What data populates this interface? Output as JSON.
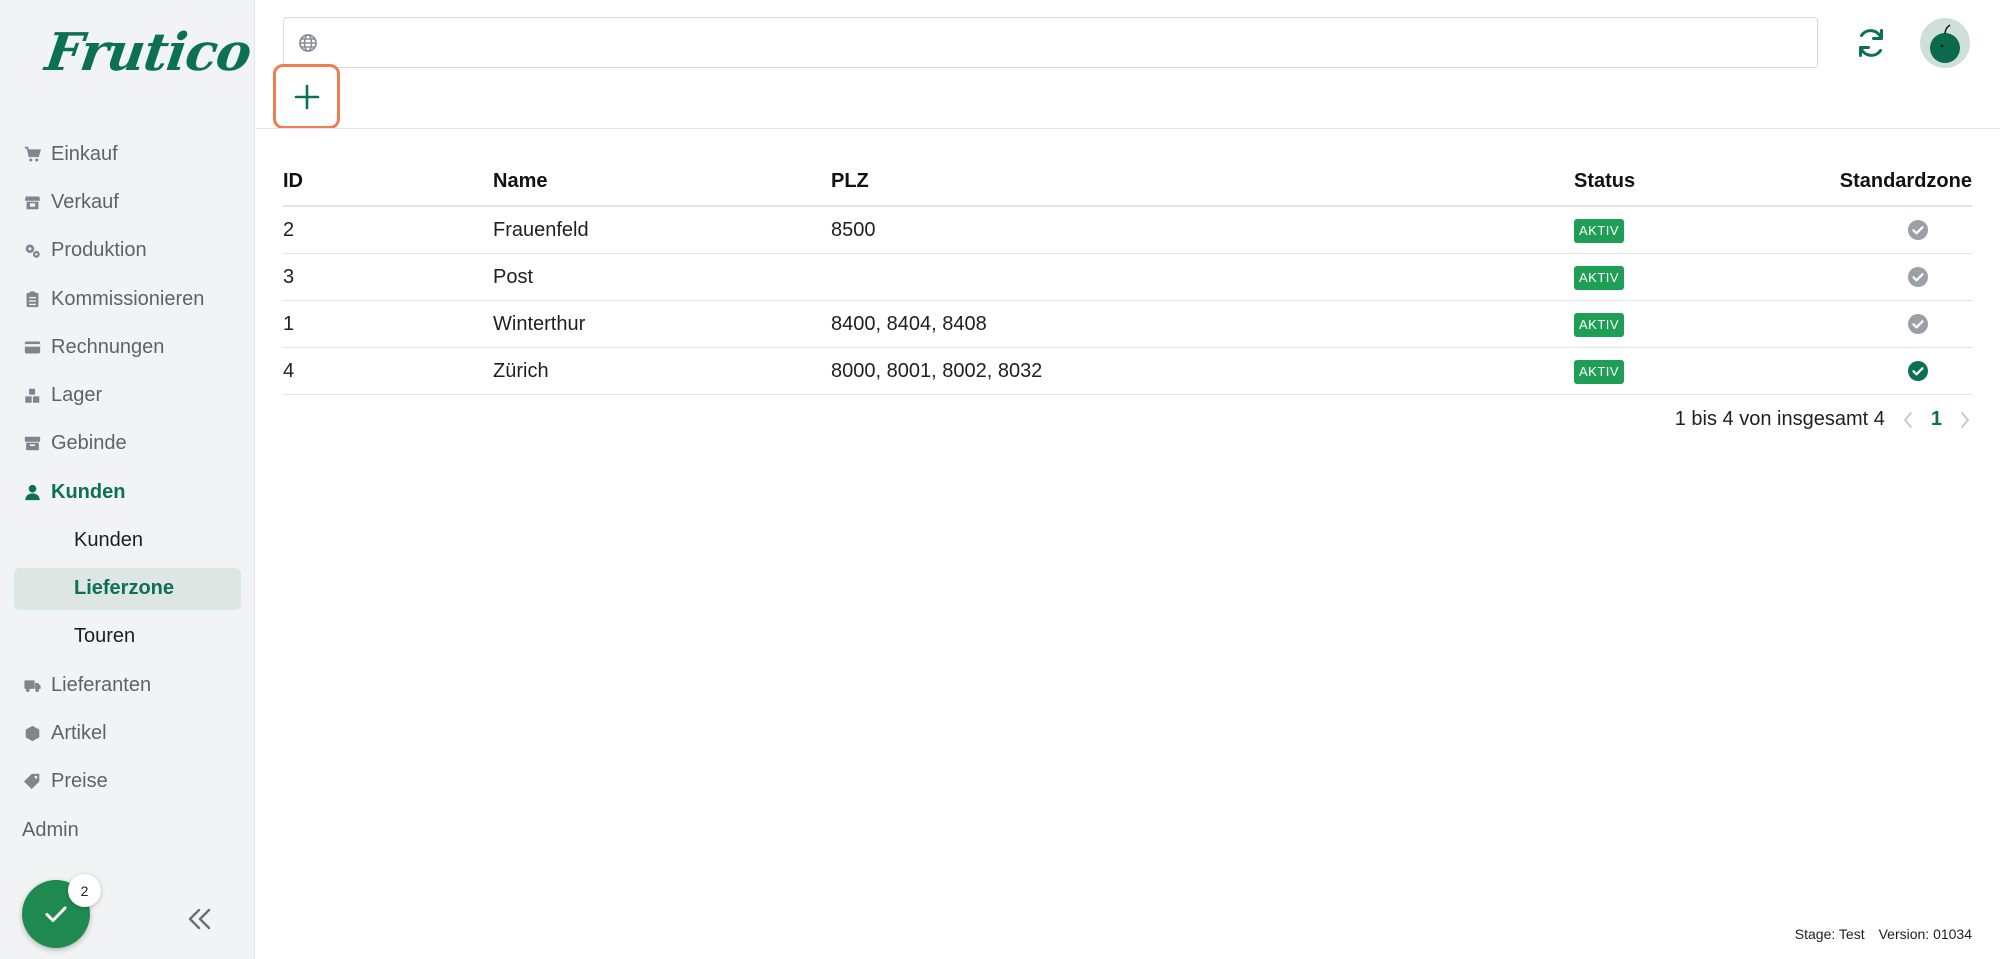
{
  "app": {
    "logo": "Frutico"
  },
  "sidebar": {
    "items": [
      {
        "label": "Einkauf",
        "icon": "cart-icon"
      },
      {
        "label": "Verkauf",
        "icon": "store-icon"
      },
      {
        "label": "Produktion",
        "icon": "gears-icon"
      },
      {
        "label": "Kommissionieren",
        "icon": "clipboard-icon"
      },
      {
        "label": "Rechnungen",
        "icon": "credit-card-icon"
      },
      {
        "label": "Lager",
        "icon": "boxes-icon"
      },
      {
        "label": "Gebinde",
        "icon": "archive-box-icon"
      },
      {
        "label": "Kunden",
        "icon": "user-icon"
      }
    ],
    "sub_items": [
      {
        "label": "Kunden"
      },
      {
        "label": "Lieferzone"
      },
      {
        "label": "Touren"
      }
    ],
    "items_after": [
      {
        "label": "Lieferanten",
        "icon": "truck-icon"
      },
      {
        "label": "Artikel",
        "icon": "cube-icon"
      },
      {
        "label": "Preise",
        "icon": "tag-icon"
      }
    ],
    "admin_label": "Admin",
    "fab_badge": "2"
  },
  "topbar": {
    "url_value": "",
    "url_placeholder": ""
  },
  "table": {
    "headers": {
      "id": "ID",
      "name": "Name",
      "plz": "PLZ",
      "status": "Status",
      "standard": "Standardzone"
    },
    "rows": [
      {
        "id": "2",
        "name": "Frauenfeld",
        "plz": "8500",
        "status": "AKTIV",
        "standard": false
      },
      {
        "id": "3",
        "name": "Post",
        "plz": "",
        "status": "AKTIV",
        "standard": false
      },
      {
        "id": "1",
        "name": "Winterthur",
        "plz": "8400, 8404, 8408",
        "status": "AKTIV",
        "standard": false
      },
      {
        "id": "4",
        "name": "Zürich",
        "plz": "8000, 8001, 8002, 8032",
        "status": "AKTIV",
        "standard": true
      }
    ]
  },
  "pagination": {
    "summary": "1 bis 4 von insgesamt 4",
    "current_page": "1"
  },
  "footer": {
    "stage": "Stage: Test",
    "version": "Version: 01034"
  },
  "colors": {
    "brand": "#0c7152",
    "status_active": "#1f9e55",
    "highlight_border": "#ef7e50",
    "check_inactive": "#9aa0a6"
  }
}
